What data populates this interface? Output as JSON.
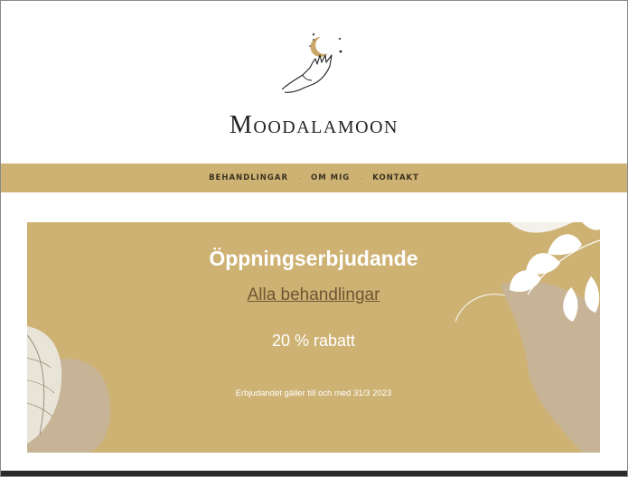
{
  "site": {
    "title": "Moodalamoon"
  },
  "nav": {
    "items": [
      {
        "label": "BEHANDLINGAR"
      },
      {
        "label": "OM MIG"
      },
      {
        "label": "KONTAKT"
      }
    ],
    "separator": "·"
  },
  "hero": {
    "title": "Öppningserbjudande",
    "link_label": "Alla behandlingar",
    "discount": "20 % rabatt",
    "note": "Erbjudandet gäller till och med 31/3 2023"
  },
  "icons": {
    "logo": "hand-holding-moon-icon",
    "deco_right": "leaves-decoration-icon",
    "deco_left": "leaf-decoration-icon"
  },
  "colors": {
    "accent": "#ceb274",
    "link": "#6e5632"
  }
}
